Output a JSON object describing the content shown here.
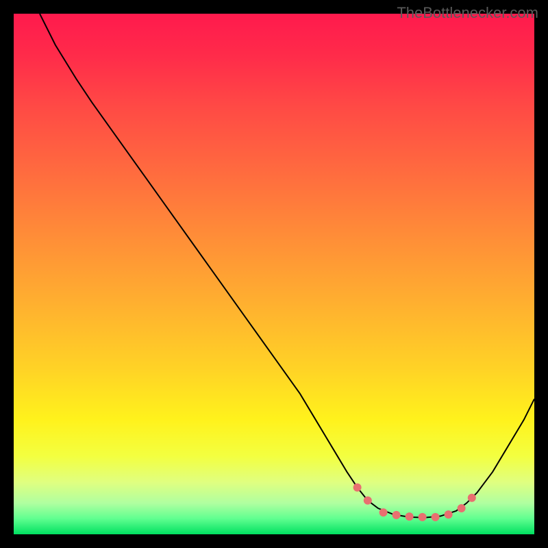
{
  "watermark": "TheBottlenecker.com",
  "chart_data": {
    "type": "line",
    "title": "",
    "xlabel": "",
    "ylabel": "",
    "xlim": [
      0,
      100
    ],
    "ylim": [
      0,
      100
    ],
    "background_gradient": {
      "type": "vertical",
      "stops": [
        {
          "offset": 0.0,
          "color": "#ff1a4d"
        },
        {
          "offset": 0.08,
          "color": "#ff2b4a"
        },
        {
          "offset": 0.18,
          "color": "#ff4a45"
        },
        {
          "offset": 0.3,
          "color": "#ff6a3f"
        },
        {
          "offset": 0.42,
          "color": "#ff8b38"
        },
        {
          "offset": 0.55,
          "color": "#ffae30"
        },
        {
          "offset": 0.68,
          "color": "#ffd226"
        },
        {
          "offset": 0.78,
          "color": "#fff21c"
        },
        {
          "offset": 0.85,
          "color": "#f3ff40"
        },
        {
          "offset": 0.9,
          "color": "#e0ff80"
        },
        {
          "offset": 0.94,
          "color": "#b0ffa0"
        },
        {
          "offset": 0.97,
          "color": "#60ff90"
        },
        {
          "offset": 1.0,
          "color": "#00e060"
        }
      ]
    },
    "series": [
      {
        "name": "curve",
        "color": "#000000",
        "width": 2,
        "points": [
          {
            "x": 5.0,
            "y": 100.0
          },
          {
            "x": 8.0,
            "y": 94.0
          },
          {
            "x": 12.0,
            "y": 87.5
          },
          {
            "x": 15.0,
            "y": 83.0
          },
          {
            "x": 20.0,
            "y": 76.0
          },
          {
            "x": 25.0,
            "y": 69.0
          },
          {
            "x": 30.0,
            "y": 62.0
          },
          {
            "x": 35.0,
            "y": 55.0
          },
          {
            "x": 40.0,
            "y": 48.0
          },
          {
            "x": 45.0,
            "y": 41.0
          },
          {
            "x": 50.0,
            "y": 34.0
          },
          {
            "x": 55.0,
            "y": 27.0
          },
          {
            "x": 58.0,
            "y": 22.0
          },
          {
            "x": 61.0,
            "y": 17.0
          },
          {
            "x": 64.0,
            "y": 12.0
          },
          {
            "x": 66.0,
            "y": 9.0
          },
          {
            "x": 68.0,
            "y": 6.5
          },
          {
            "x": 70.0,
            "y": 5.0
          },
          {
            "x": 73.0,
            "y": 3.8
          },
          {
            "x": 76.0,
            "y": 3.3
          },
          {
            "x": 79.0,
            "y": 3.2
          },
          {
            "x": 82.0,
            "y": 3.5
          },
          {
            "x": 85.0,
            "y": 4.5
          },
          {
            "x": 87.0,
            "y": 6.0
          },
          {
            "x": 89.0,
            "y": 8.0
          },
          {
            "x": 92.0,
            "y": 12.0
          },
          {
            "x": 95.0,
            "y": 17.0
          },
          {
            "x": 98.0,
            "y": 22.0
          },
          {
            "x": 100.0,
            "y": 26.0
          }
        ]
      }
    ],
    "markers": {
      "color": "#e87070",
      "radius": 6,
      "points": [
        {
          "x": 66.0,
          "y": 9.0
        },
        {
          "x": 68.0,
          "y": 6.5
        },
        {
          "x": 71.0,
          "y": 4.2
        },
        {
          "x": 73.5,
          "y": 3.7
        },
        {
          "x": 76.0,
          "y": 3.4
        },
        {
          "x": 78.5,
          "y": 3.3
        },
        {
          "x": 81.0,
          "y": 3.3
        },
        {
          "x": 83.5,
          "y": 3.8
        },
        {
          "x": 86.0,
          "y": 5.0
        },
        {
          "x": 88.0,
          "y": 7.0
        }
      ]
    }
  }
}
